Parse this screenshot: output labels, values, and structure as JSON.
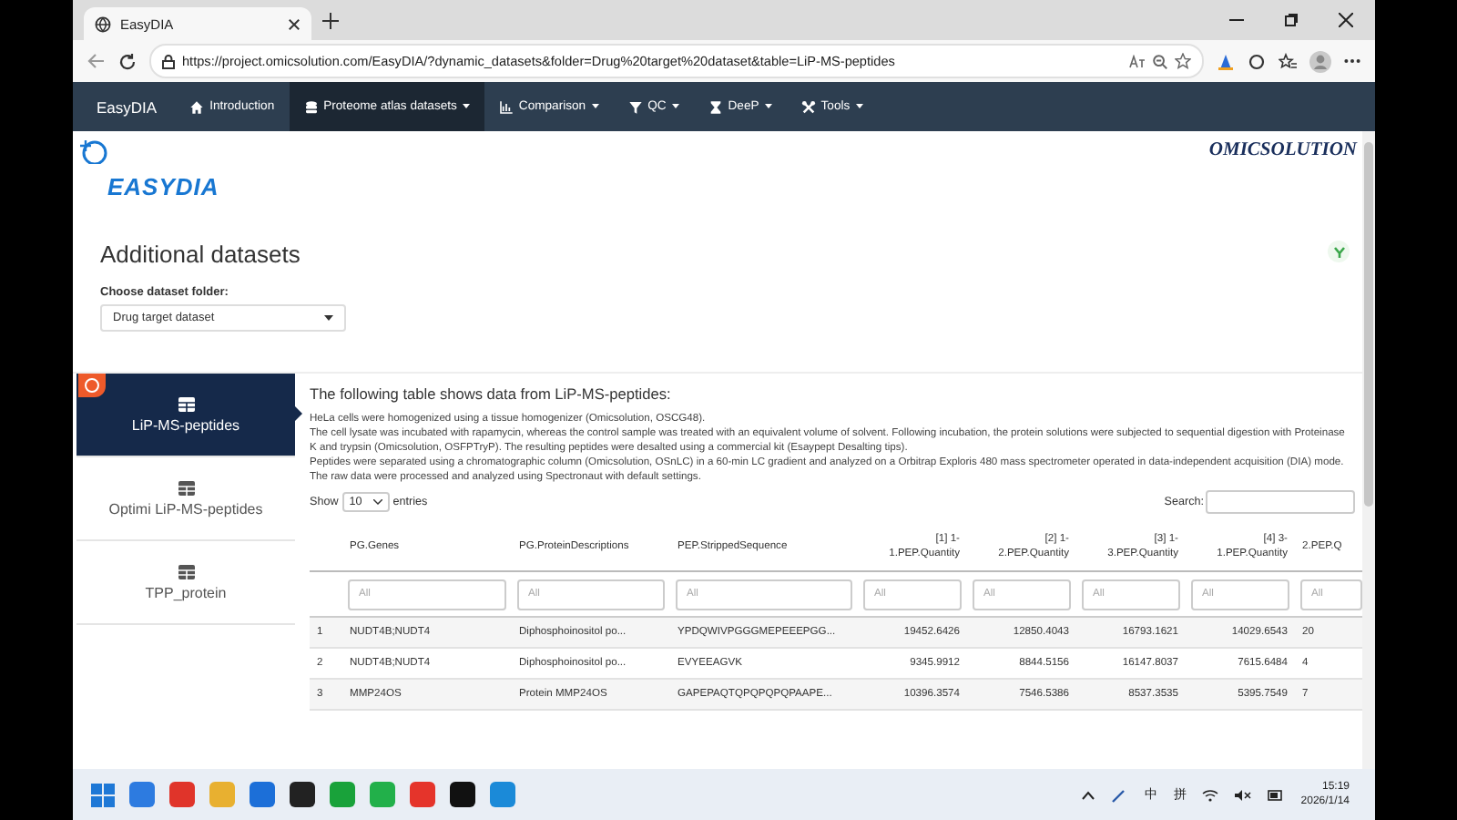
{
  "browser": {
    "tab_title": "EasyDIA",
    "url": "https://project.omicsolution.com/EasyDIA/?dynamic_datasets&folder=Drug%20target%20dataset&table=LiP-MS-peptides"
  },
  "navbar": {
    "brand": "EasyDIA",
    "items": [
      {
        "label": "Introduction",
        "dropdown": false,
        "selected": false
      },
      {
        "label": "Proteome atlas datasets",
        "dropdown": true,
        "selected": true
      },
      {
        "label": "Comparison",
        "dropdown": true,
        "selected": false
      },
      {
        "label": "QC",
        "dropdown": true,
        "selected": false
      },
      {
        "label": "DeeP",
        "dropdown": true,
        "selected": false
      },
      {
        "label": "Tools",
        "dropdown": true,
        "selected": false
      }
    ]
  },
  "logos": {
    "left": "EASYDIA",
    "right": "OMICSOLUTION"
  },
  "heading": "Additional datasets",
  "folder_select": {
    "label": "Choose dataset folder:",
    "value": "Drug target dataset"
  },
  "side_tabs": [
    {
      "label": "LiP-MS-peptides",
      "selected": true
    },
    {
      "label": "Optimi LiP-MS-peptides",
      "selected": false
    },
    {
      "label": "TPP_protein",
      "selected": false
    }
  ],
  "panel": {
    "title": "The following table shows data from LiP-MS-peptides:",
    "paragraphs": [
      "HeLa cells were homogenized using a tissue homogenizer (Omicsolution, OSCG48).",
      "The cell lysate was incubated with rapamycin, whereas the control sample was treated with an equivalent volume of solvent. Following incubation, the protein solutions were subjected to sequential digestion with Proteinase K and trypsin (Omicsolution, OSFPTryP). The resulting peptides were desalted using a commercial kit (Esaypept Desalting tips).",
      "Peptides were separated using a chromatographic column (Omicsolution, OSnLC) in a 60-min LC gradient and analyzed on a Orbitrap Exploris 480 mass spectrometer operated in data-independent acquisition (DIA) mode.",
      "The raw data were processed and analyzed using Spectronaut with default settings."
    ],
    "show_label": "Show",
    "page_length": "10",
    "entries_label": "entries",
    "search_label": "Search:"
  },
  "table": {
    "columns": [
      "PG.Genes",
      "PG.ProteinDescriptions",
      "PEP.StrippedSequence",
      "[1] 1-\n1.PEP.Quantity",
      "[2] 1-\n2.PEP.Quantity",
      "[3] 1-\n3.PEP.Quantity",
      "[4] 3-\n1.PEP.Quantity",
      "2.PEP.Q"
    ],
    "filters": [
      {
        "placeholder": "All"
      },
      {
        "placeholder": "All"
      },
      {
        "placeholder": "All"
      },
      {
        "placeholder": "All"
      },
      {
        "placeholder": "All"
      },
      {
        "placeholder": "All"
      },
      {
        "placeholder": "All"
      },
      {
        "placeholder": "All"
      }
    ],
    "rows": [
      {
        "index": "1",
        "cells": [
          "NUDT4B;NUDT4",
          "Diphosphoinositol po...",
          "YPDQWIVPGGGMEPEEEPGG...",
          "19452.6426",
          "12850.4043",
          "16793.1621",
          "14029.6543",
          "20"
        ]
      },
      {
        "index": "2",
        "cells": [
          "NUDT4B;NUDT4",
          "Diphosphoinositol po...",
          "EVYEEAGVK",
          "9345.9912",
          "8844.5156",
          "16147.8037",
          "7615.6484",
          "4"
        ]
      },
      {
        "index": "3",
        "cells": [
          "MMP24OS",
          "Protein MMP24OS",
          "GAPEPAQTQPQPQPQPAAPE...",
          "10396.3574",
          "7546.5386",
          "8537.3535",
          "5395.7549",
          "7"
        ]
      }
    ]
  },
  "taskbar": {
    "ime_mode": "中",
    "ime_name": "拼",
    "time": "15:19",
    "date": "2026/1/14"
  }
}
